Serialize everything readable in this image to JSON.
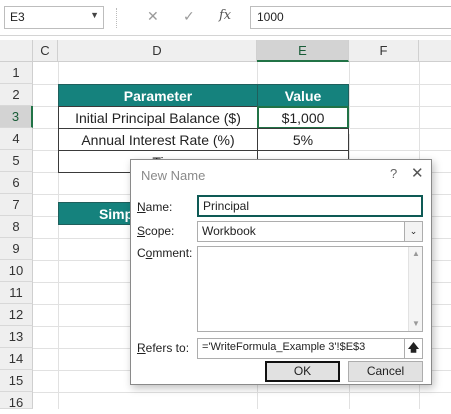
{
  "formula_bar": {
    "name_box": "E3",
    "cancel_icon": "✕",
    "enter_icon": "✓",
    "fx_label": "fx",
    "formula": "1000"
  },
  "columns": [
    "C",
    "D",
    "E",
    "F"
  ],
  "active_column": "E",
  "rows": [
    "1",
    "2",
    "3",
    "4",
    "5",
    "6",
    "7",
    "8",
    "9",
    "10",
    "11",
    "12",
    "13",
    "14",
    "15",
    "16"
  ],
  "active_row": "3",
  "table": {
    "header_parameter": "Parameter",
    "header_value": "Value",
    "row3_label": "Initial Principal Balance ($)",
    "row3_value": "$1,000",
    "row4_label": "Annual Interest Rate (%)",
    "row4_value": "5%",
    "row5_label_partial": "Ti",
    "row7_label_partial": "Simpl"
  },
  "dialog": {
    "title": "New Name",
    "help": "?",
    "close": "✕",
    "name_label_underlined": "N",
    "name_label_rest": "ame:",
    "name_value": "Principal",
    "scope_label_underlined": "S",
    "scope_label_rest": "cope:",
    "scope_value": "Workbook",
    "comment_label_pre": "C",
    "comment_label_underlined": "o",
    "comment_label_rest": "mment:",
    "refers_label_underlined": "R",
    "refers_label_rest": "efers to:",
    "refers_value": "='WriteFormula_Example 3'!$E$3",
    "ok_label": "OK",
    "cancel_label": "Cancel"
  },
  "colors": {
    "header_fill": "#15827d",
    "selection": "#217346"
  }
}
